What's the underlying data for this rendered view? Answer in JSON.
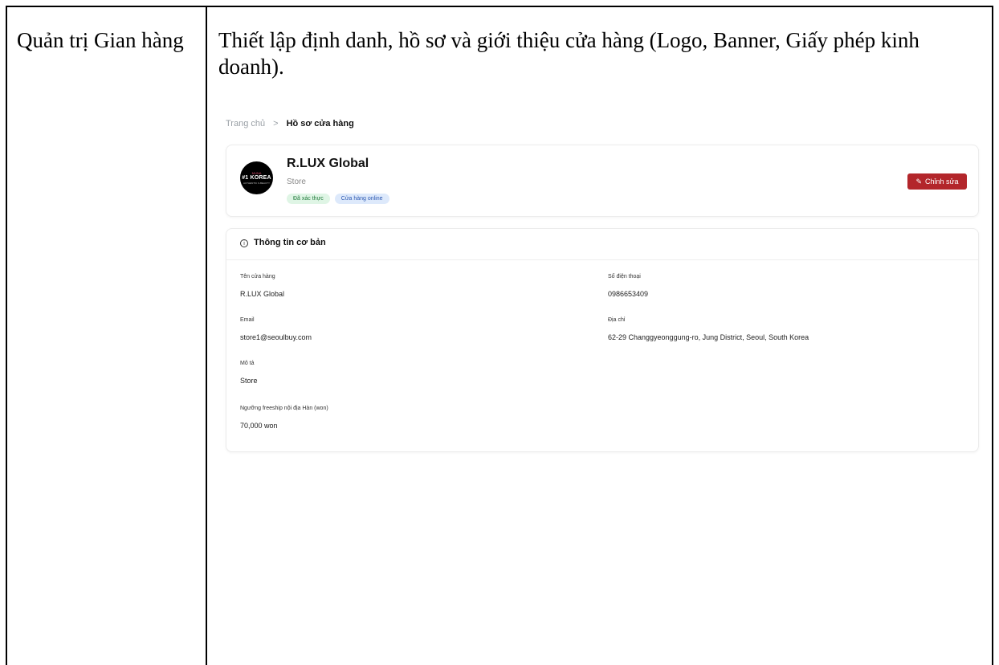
{
  "document": {
    "row_label": "Quản trị Gian hàng",
    "row_description": "Thiết lập định danh, hồ sơ và giới thiệu cửa hàng (Logo, Banner, Giấy phép kinh doanh)."
  },
  "screenshot": {
    "breadcrumb": {
      "home": "Trang chủ",
      "separator": ">",
      "current": "Hồ sơ cửa hàng"
    },
    "store": {
      "logo_text": {
        "top": "MUNA",
        "main": "#1 KOREA",
        "sub": "AUTHENTIC K-BEAUTY"
      },
      "name": "R.LUX Global",
      "type": "Store",
      "badges": {
        "verified": "Đã xác thực",
        "online": "Cửa hàng online"
      },
      "edit_button": "Chỉnh sửa"
    },
    "basic_info": {
      "title": "Thông tin cơ bản",
      "fields": {
        "store_name": {
          "label": "Tên cửa hàng",
          "value": "R.LUX Global"
        },
        "phone": {
          "label": "Số điện thoại",
          "value": "0986653409"
        },
        "email": {
          "label": "Email",
          "value": "store1@seoulbuy.com"
        },
        "address": {
          "label": "Địa chỉ",
          "value": "62-29 Changgyeonggung-ro, Jung District, Seoul, South Korea"
        },
        "description": {
          "label": "Mô tả",
          "value": "Store"
        },
        "freeship": {
          "label": "Ngưỡng freeship nội địa Hàn (won)",
          "value": "70,000 won"
        }
      }
    },
    "colors": {
      "accent": "#b3262b",
      "verified_bg": "#dff5e5",
      "online_bg": "#dde9fb"
    }
  }
}
